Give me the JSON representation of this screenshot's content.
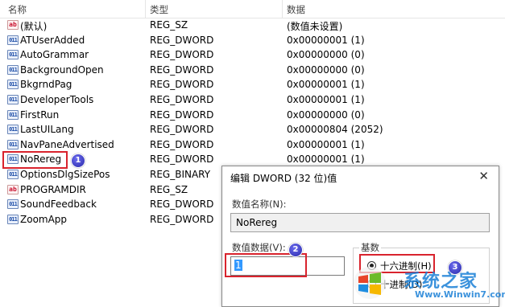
{
  "columns": {
    "name": "名称",
    "type": "类型",
    "data": "数据"
  },
  "rows": [
    {
      "icon": "ab",
      "kind": "str",
      "name": "(默认)",
      "type": "REG_SZ",
      "data": "(数值未设置)"
    },
    {
      "icon": "011",
      "kind": "bin",
      "name": "ATUserAdded",
      "type": "REG_DWORD",
      "data": "0x00000001 (1)"
    },
    {
      "icon": "011",
      "kind": "bin",
      "name": "AutoGrammar",
      "type": "REG_DWORD",
      "data": "0x00000000 (0)"
    },
    {
      "icon": "011",
      "kind": "bin",
      "name": "BackgroundOpen",
      "type": "REG_DWORD",
      "data": "0x00000000 (0)"
    },
    {
      "icon": "011",
      "kind": "bin",
      "name": "BkgrndPag",
      "type": "REG_DWORD",
      "data": "0x00000001 (1)"
    },
    {
      "icon": "011",
      "kind": "bin",
      "name": "DeveloperTools",
      "type": "REG_DWORD",
      "data": "0x00000001 (1)"
    },
    {
      "icon": "011",
      "kind": "bin",
      "name": "FirstRun",
      "type": "REG_DWORD",
      "data": "0x00000000 (0)"
    },
    {
      "icon": "011",
      "kind": "bin",
      "name": "LastUILang",
      "type": "REG_DWORD",
      "data": "0x00000804 (2052)"
    },
    {
      "icon": "011",
      "kind": "bin",
      "name": "NavPaneAdvertised",
      "type": "REG_DWORD",
      "data": "0x00000001 (1)"
    },
    {
      "icon": "011",
      "kind": "bin",
      "name": "NoRereg",
      "type": "REG_DWORD",
      "data": "0x00000001 (1)"
    },
    {
      "icon": "011",
      "kind": "bin",
      "name": "OptionsDlgSizePos",
      "type": "REG_BINARY",
      "data": ""
    },
    {
      "icon": "ab",
      "kind": "str",
      "name": "PROGRAMDIR",
      "type": "REG_SZ",
      "data": ""
    },
    {
      "icon": "011",
      "kind": "bin",
      "name": "SoundFeedback",
      "type": "REG_DWORD",
      "data": ""
    },
    {
      "icon": "011",
      "kind": "bin",
      "name": "ZoomApp",
      "type": "REG_DWORD",
      "data": ""
    }
  ],
  "badges": {
    "one": "1",
    "two": "2",
    "three": "3"
  },
  "dialog": {
    "title": "编辑 DWORD (32 位)值",
    "close": "✕",
    "value_name_label": "数值名称(N):",
    "value_name": "NoRereg",
    "value_data_label": "数值数据(V):",
    "value_data": "1",
    "base_label": "基数",
    "hex_label": "十六进制(H)",
    "dec_label": "十进制(D)",
    "selected_base": "hex"
  },
  "watermark": {
    "main": "系统之家",
    "url": "Www.Winwin7.com"
  },
  "colors": {
    "highlight": "#d9232d",
    "badge": "#2a2aa8",
    "selection": "#3399ff"
  }
}
